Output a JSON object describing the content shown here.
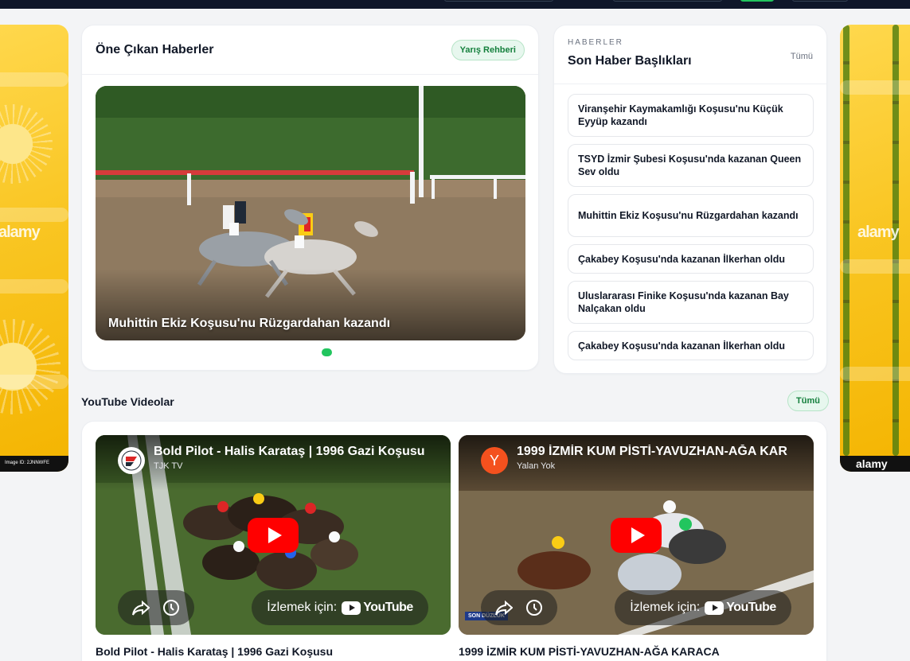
{
  "ads": {
    "left_watermark": "alamy",
    "left_footer": "Image ID: 2JNNWFE",
    "right_watermark": "alamy",
    "right_footer": "alamy"
  },
  "featured": {
    "title": "Öne Çıkan Haberler",
    "guide_button": "Yarış Rehberi",
    "slides": [
      {
        "caption": "Muhittin Ekiz Koşusu'nu Rüzgardahan kazandı"
      }
    ],
    "active_slide": 1
  },
  "headlines": {
    "kicker": "HABERLER",
    "title": "Son Haber Başlıkları",
    "all_link": "Tümü",
    "items": [
      "Viranşehir Kaymakamlığı Koşusu'nu Küçük Eyyüp kazandı",
      "TSYD İzmir Şubesi Koşusu'nda kazanan Queen Sev oldu",
      "Muhittin Ekiz Koşusu'nu Rüzgardahan kazandı",
      "Çakabey Koşusu'nda kazanan İlkerhan oldu",
      "Uluslararası Finike Koşusu'nda kazanan Bay Nalçakan oldu",
      "Çakabey Koşusu'nda kazanan İlkerhan oldu"
    ]
  },
  "videos": {
    "section_title": "YouTube Videolar",
    "all_link": "Tümü",
    "watch_on": "İzlemek için:",
    "youtube_brand": "YouTube",
    "items": [
      {
        "title": "Bold Pilot - Halis Karataş | 1996 Gazi Koşusu",
        "channel": "TJK TV",
        "caption": "Bold Pilot - Halis Karataş | 1996 Gazi Koşusu"
      },
      {
        "title": "1999 İZMİR KUM PİSTİ-YAVUZHAN-AĞA KARACA",
        "channel": "Yalan Yok",
        "channel_initial": "Y",
        "caption": "1999 İZMİR KUM PİSTİ-YAVUZHAN-AĞA KARACA",
        "overlay_badge": "SON DÜZLÜK"
      }
    ]
  },
  "colors": {
    "accent_green": "#22c55e",
    "badge_bg": "#e7f7ee",
    "youtube_red": "#ff0000"
  }
}
